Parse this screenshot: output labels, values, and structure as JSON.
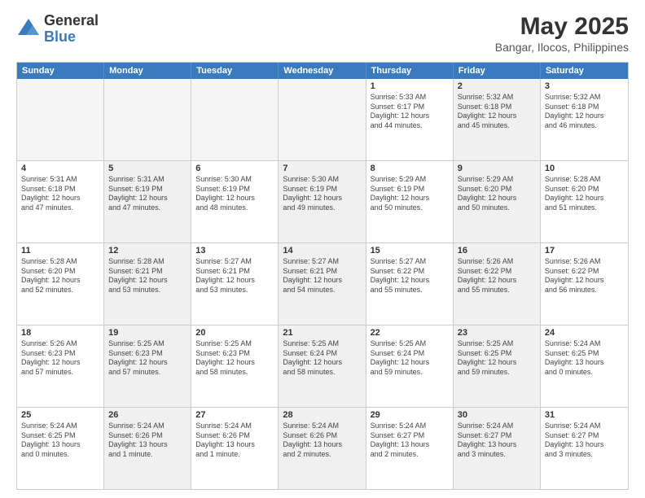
{
  "logo": {
    "general": "General",
    "blue": "Blue"
  },
  "title": "May 2025",
  "subtitle": "Bangar, Ilocos, Philippines",
  "weekdays": [
    "Sunday",
    "Monday",
    "Tuesday",
    "Wednesday",
    "Thursday",
    "Friday",
    "Saturday"
  ],
  "weeks": [
    [
      {
        "day": "",
        "info": "",
        "empty": true
      },
      {
        "day": "",
        "info": "",
        "empty": true
      },
      {
        "day": "",
        "info": "",
        "empty": true
      },
      {
        "day": "",
        "info": "",
        "empty": true
      },
      {
        "day": "1",
        "info": "Sunrise: 5:33 AM\nSunset: 6:17 PM\nDaylight: 12 hours\nand 44 minutes."
      },
      {
        "day": "2",
        "info": "Sunrise: 5:32 AM\nSunset: 6:18 PM\nDaylight: 12 hours\nand 45 minutes.",
        "shaded": true
      },
      {
        "day": "3",
        "info": "Sunrise: 5:32 AM\nSunset: 6:18 PM\nDaylight: 12 hours\nand 46 minutes."
      }
    ],
    [
      {
        "day": "4",
        "info": "Sunrise: 5:31 AM\nSunset: 6:18 PM\nDaylight: 12 hours\nand 47 minutes."
      },
      {
        "day": "5",
        "info": "Sunrise: 5:31 AM\nSunset: 6:19 PM\nDaylight: 12 hours\nand 47 minutes.",
        "shaded": true
      },
      {
        "day": "6",
        "info": "Sunrise: 5:30 AM\nSunset: 6:19 PM\nDaylight: 12 hours\nand 48 minutes."
      },
      {
        "day": "7",
        "info": "Sunrise: 5:30 AM\nSunset: 6:19 PM\nDaylight: 12 hours\nand 49 minutes.",
        "shaded": true
      },
      {
        "day": "8",
        "info": "Sunrise: 5:29 AM\nSunset: 6:19 PM\nDaylight: 12 hours\nand 50 minutes."
      },
      {
        "day": "9",
        "info": "Sunrise: 5:29 AM\nSunset: 6:20 PM\nDaylight: 12 hours\nand 50 minutes.",
        "shaded": true
      },
      {
        "day": "10",
        "info": "Sunrise: 5:28 AM\nSunset: 6:20 PM\nDaylight: 12 hours\nand 51 minutes."
      }
    ],
    [
      {
        "day": "11",
        "info": "Sunrise: 5:28 AM\nSunset: 6:20 PM\nDaylight: 12 hours\nand 52 minutes."
      },
      {
        "day": "12",
        "info": "Sunrise: 5:28 AM\nSunset: 6:21 PM\nDaylight: 12 hours\nand 53 minutes.",
        "shaded": true
      },
      {
        "day": "13",
        "info": "Sunrise: 5:27 AM\nSunset: 6:21 PM\nDaylight: 12 hours\nand 53 minutes."
      },
      {
        "day": "14",
        "info": "Sunrise: 5:27 AM\nSunset: 6:21 PM\nDaylight: 12 hours\nand 54 minutes.",
        "shaded": true
      },
      {
        "day": "15",
        "info": "Sunrise: 5:27 AM\nSunset: 6:22 PM\nDaylight: 12 hours\nand 55 minutes."
      },
      {
        "day": "16",
        "info": "Sunrise: 5:26 AM\nSunset: 6:22 PM\nDaylight: 12 hours\nand 55 minutes.",
        "shaded": true
      },
      {
        "day": "17",
        "info": "Sunrise: 5:26 AM\nSunset: 6:22 PM\nDaylight: 12 hours\nand 56 minutes."
      }
    ],
    [
      {
        "day": "18",
        "info": "Sunrise: 5:26 AM\nSunset: 6:23 PM\nDaylight: 12 hours\nand 57 minutes."
      },
      {
        "day": "19",
        "info": "Sunrise: 5:25 AM\nSunset: 6:23 PM\nDaylight: 12 hours\nand 57 minutes.",
        "shaded": true
      },
      {
        "day": "20",
        "info": "Sunrise: 5:25 AM\nSunset: 6:23 PM\nDaylight: 12 hours\nand 58 minutes."
      },
      {
        "day": "21",
        "info": "Sunrise: 5:25 AM\nSunset: 6:24 PM\nDaylight: 12 hours\nand 58 minutes.",
        "shaded": true
      },
      {
        "day": "22",
        "info": "Sunrise: 5:25 AM\nSunset: 6:24 PM\nDaylight: 12 hours\nand 59 minutes."
      },
      {
        "day": "23",
        "info": "Sunrise: 5:25 AM\nSunset: 6:25 PM\nDaylight: 12 hours\nand 59 minutes.",
        "shaded": true
      },
      {
        "day": "24",
        "info": "Sunrise: 5:24 AM\nSunset: 6:25 PM\nDaylight: 13 hours\nand 0 minutes."
      }
    ],
    [
      {
        "day": "25",
        "info": "Sunrise: 5:24 AM\nSunset: 6:25 PM\nDaylight: 13 hours\nand 0 minutes."
      },
      {
        "day": "26",
        "info": "Sunrise: 5:24 AM\nSunset: 6:26 PM\nDaylight: 13 hours\nand 1 minute.",
        "shaded": true
      },
      {
        "day": "27",
        "info": "Sunrise: 5:24 AM\nSunset: 6:26 PM\nDaylight: 13 hours\nand 1 minute."
      },
      {
        "day": "28",
        "info": "Sunrise: 5:24 AM\nSunset: 6:26 PM\nDaylight: 13 hours\nand 2 minutes.",
        "shaded": true
      },
      {
        "day": "29",
        "info": "Sunrise: 5:24 AM\nSunset: 6:27 PM\nDaylight: 13 hours\nand 2 minutes."
      },
      {
        "day": "30",
        "info": "Sunrise: 5:24 AM\nSunset: 6:27 PM\nDaylight: 13 hours\nand 3 minutes.",
        "shaded": true
      },
      {
        "day": "31",
        "info": "Sunrise: 5:24 AM\nSunset: 6:27 PM\nDaylight: 13 hours\nand 3 minutes."
      }
    ]
  ]
}
